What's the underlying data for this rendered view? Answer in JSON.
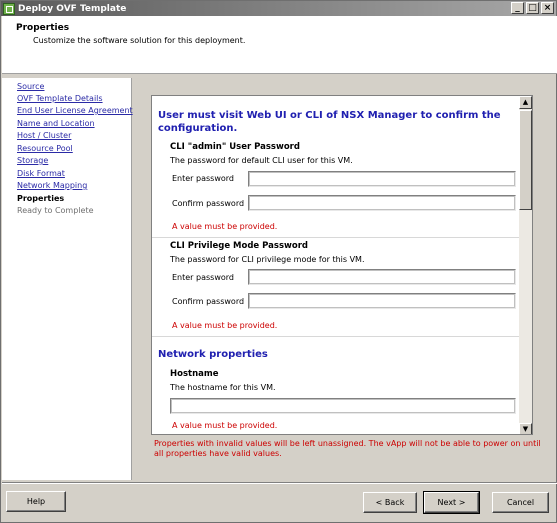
{
  "window": {
    "title": "Deploy OVF Template",
    "controls": {
      "minimize": "_",
      "maximize": "□",
      "close": "×"
    }
  },
  "header": {
    "title": "Properties",
    "subtitle": "Customize the software solution for this deployment."
  },
  "nav": {
    "items": [
      {
        "label": "Source",
        "state": "link"
      },
      {
        "label": "OVF Template Details",
        "state": "link"
      },
      {
        "label": "End User License Agreement",
        "state": "link"
      },
      {
        "label": "Name and Location",
        "state": "link"
      },
      {
        "label": "Host / Cluster",
        "state": "link"
      },
      {
        "label": "Resource Pool",
        "state": "link"
      },
      {
        "label": "Storage",
        "state": "link"
      },
      {
        "label": "Disk Format",
        "state": "link"
      },
      {
        "label": "Network Mapping",
        "state": "link"
      },
      {
        "label": "Properties",
        "state": "current"
      },
      {
        "label": "Ready to Complete",
        "state": "disabled"
      }
    ]
  },
  "properties": {
    "intro_heading": "User must visit Web UI or CLI of NSX Manager to confirm the configuration.",
    "cli_admin": {
      "title": "CLI \"admin\" User Password",
      "description": "The password for default CLI user for this VM.",
      "enter_label": "Enter password",
      "confirm_label": "Confirm password",
      "enter_value": "",
      "confirm_value": "",
      "error": "A value must be provided."
    },
    "cli_privilege": {
      "title": "CLI Privilege Mode Password",
      "description": "The password for CLI privilege mode for this VM.",
      "enter_label": "Enter password",
      "confirm_label": "Confirm password",
      "enter_value": "",
      "confirm_value": "",
      "error": "A value must be provided."
    },
    "network_heading": "Network properties",
    "hostname": {
      "title": "Hostname",
      "description": "The hostname for this VM.",
      "value": "",
      "error": "A value must be provided."
    }
  },
  "footer_warning": "Properties with invalid values will be left unassigned. The vApp will not be able to power on until all properties have valid values.",
  "buttons": {
    "help": "Help",
    "back": "< Back",
    "next": "Next >",
    "cancel": "Cancel"
  },
  "scrollbar": {
    "up_arrow": "▲",
    "down_arrow": "▼"
  },
  "colors": {
    "link": "#2a2aa6",
    "heading_blue": "#2020b0",
    "error_red": "#cc0000",
    "dialog_gray": "#d4d0c8"
  }
}
